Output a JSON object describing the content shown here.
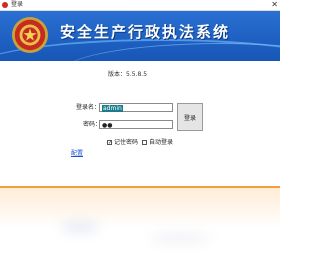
{
  "window": {
    "title": "登录",
    "close_glyph": "✕"
  },
  "banner": {
    "title": "安全生产行政执法系统",
    "bg_color": "#1c5fc2",
    "emblem_icon": "national-emblem-icon"
  },
  "version": {
    "label": "版本：",
    "value": "5.5.8.5"
  },
  "form": {
    "username_label": "登录名：",
    "username_value": "admin",
    "password_label": "密码：",
    "password_value": "●●",
    "login_button": "登录",
    "remember_password_label": "记住密码",
    "remember_password_checked": true,
    "auto_login_label": "自动登录",
    "auto_login_checked": false,
    "config_link": "配置"
  },
  "accent_colors": {
    "footer_line": "#f0a040",
    "selection": "#1a7c8c",
    "link": "#1a4fd1"
  }
}
